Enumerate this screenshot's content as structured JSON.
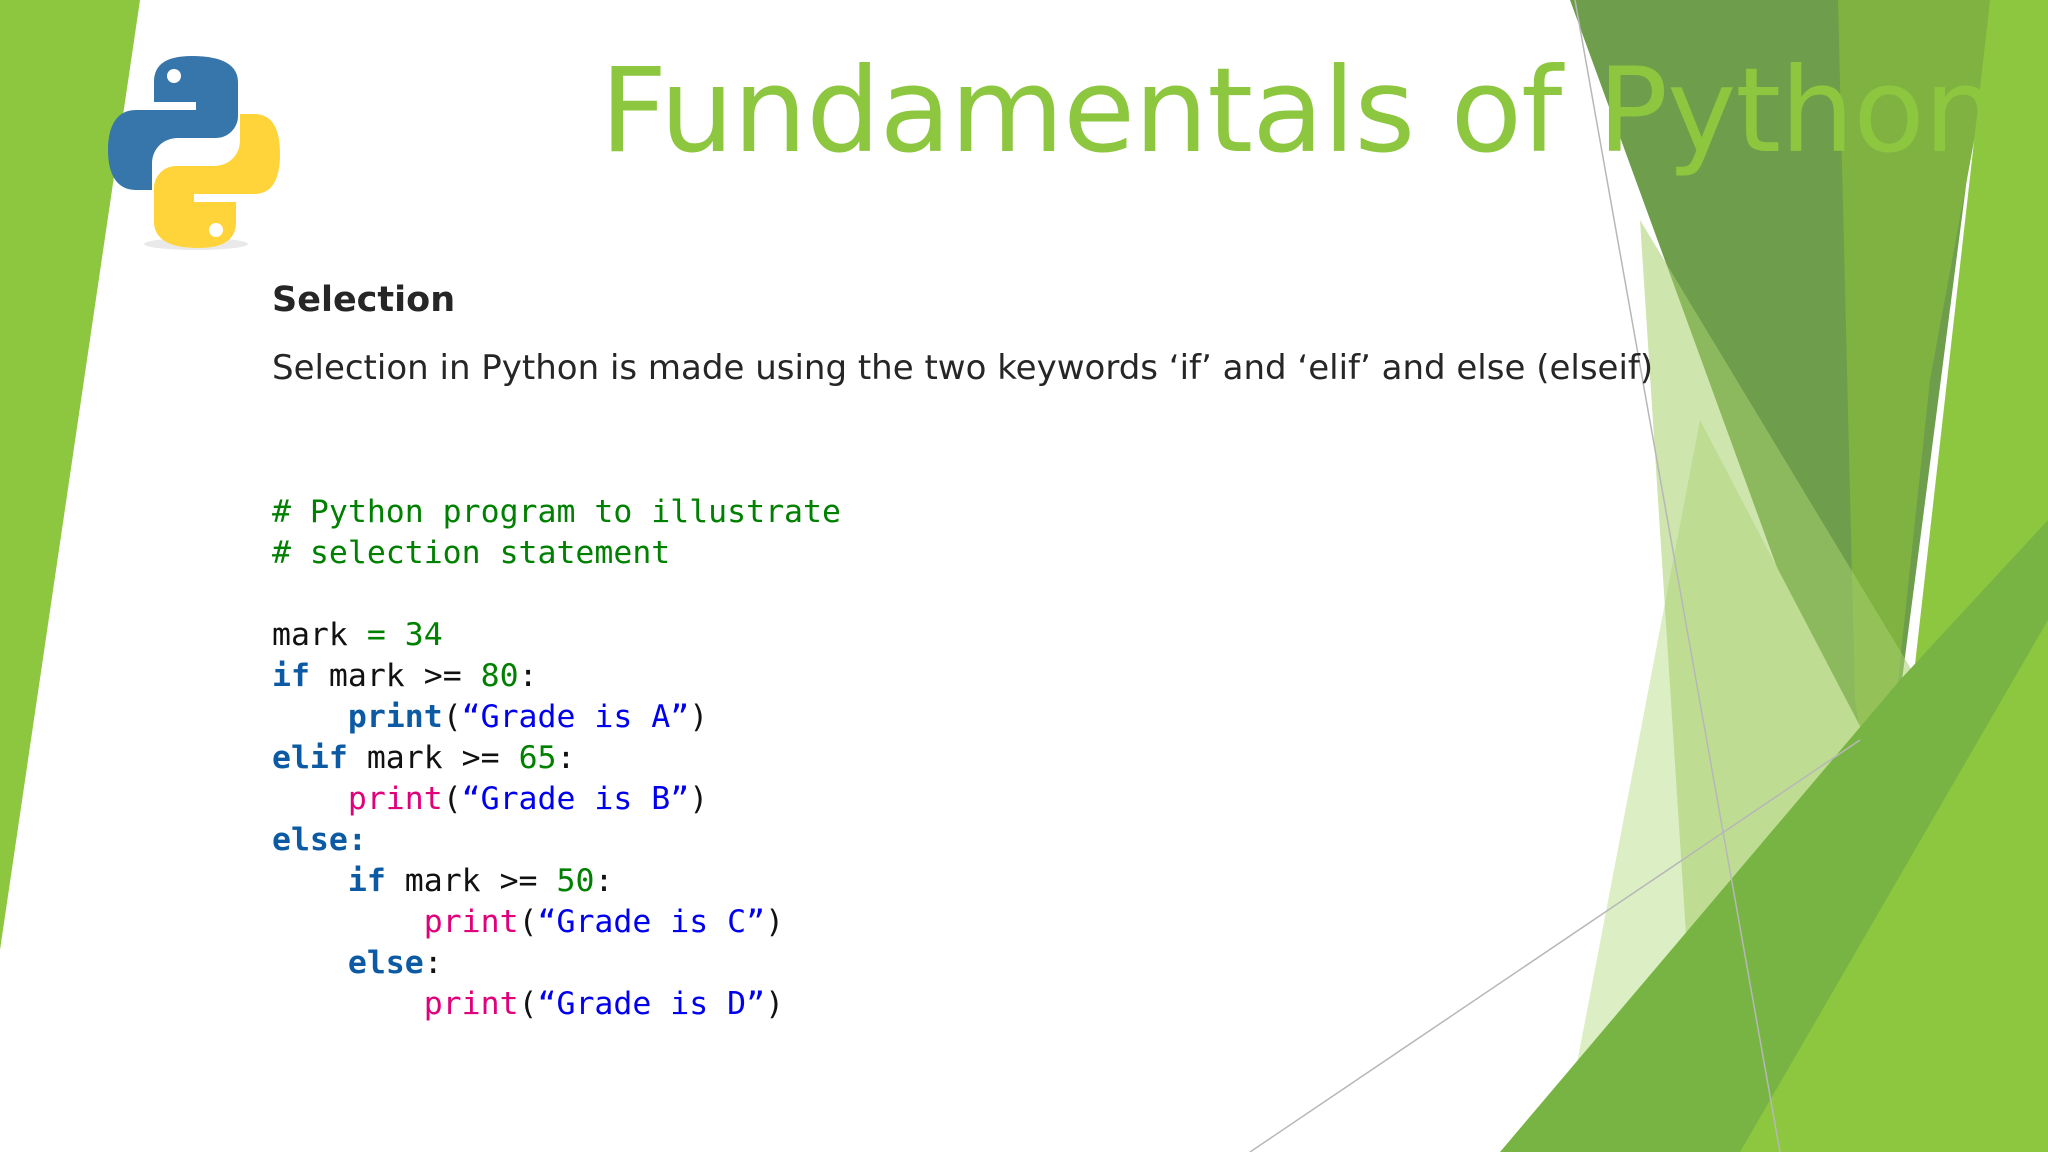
{
  "slide": {
    "title": "Fundamentals of Python",
    "heading": "Selection",
    "description": "Selection in Python is made using the two keywords ‘if’ and ‘elif’ and else (elseif)"
  },
  "logo": {
    "icon": "python-logo-icon"
  },
  "colors": {
    "accent": "#8dc63f",
    "deco_dark": "#6a9a4a",
    "deco_mid": "#7bb241",
    "deco_light": "#d9ecc0"
  },
  "code": {
    "comment_1": "# Python program to illustrate",
    "comment_2": "# selection statement",
    "l3_var": "mark",
    "l3_op": "=",
    "l3_num": "34",
    "l4_kw": "if",
    "l4_expr": "mark >=",
    "l4_num": "80",
    "l4_colon": ":",
    "l5_fn": "print",
    "l5_open": "(",
    "l5_str": "“Grade is A”",
    "l5_close": ")",
    "l6_kw": "elif",
    "l6_expr": "mark >=",
    "l6_num": "65",
    "l6_colon": ":",
    "l7_fn": "print",
    "l7_open": "(",
    "l7_str": "“Grade is B”",
    "l7_close": ")",
    "l8_kw": "else:",
    "l9_kw": "if",
    "l9_expr": "mark >=",
    "l9_num": "50",
    "l9_colon": ":",
    "l10_fn": "print",
    "l10_open": "(",
    "l10_str": "“Grade is C”",
    "l10_close": ")",
    "l11_kw": "else",
    "l11_colon": ":",
    "l12_fn": "print",
    "l12_open": "(",
    "l12_str": "“Grade is D”",
    "l12_close": ")"
  }
}
